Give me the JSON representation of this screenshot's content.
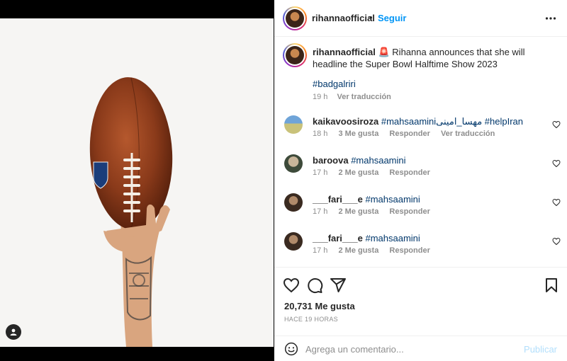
{
  "post": {
    "username": "rihannaofficial",
    "follow_separator": "•",
    "follow_label": "Seguir",
    "more_icon": "more-horizontal-icon"
  },
  "caption": {
    "username": "rihannaofficial",
    "emoji": "🚨",
    "text": "Rihanna announces that she will headline the Super Bowl Halftime Show 2023",
    "hashtag": "#badgalriri",
    "time": "19 h",
    "translate": "Ver traducción"
  },
  "comments": [
    {
      "username": "kaikavoosiroza",
      "text_tag1": "#mahsaamini",
      "text_mid": "مهسا_امینی",
      "text_tag2": "#helpIran",
      "time": "18 h",
      "likes": "3 Me gusta",
      "reply": "Responder",
      "translate": "Ver traducción"
    },
    {
      "username": "baroova",
      "text_tag1": "#mahsaamini",
      "time": "17 h",
      "likes": "2 Me gusta",
      "reply": "Responder"
    },
    {
      "username": "___fari___e",
      "text_tag1": "#mahsaamini",
      "time": "17 h",
      "likes": "2 Me gusta",
      "reply": "Responder"
    },
    {
      "username": "___fari___e",
      "text_tag1": "#mahsaamini",
      "time": "17 h",
      "likes": "2 Me gusta",
      "reply": "Responder"
    }
  ],
  "actions": {
    "likes": "20,731 Me gusta",
    "time": "HACE 19 HORAS"
  },
  "comment_box": {
    "placeholder": "Agrega un comentario...",
    "publish": "Publicar"
  },
  "colors": {
    "accent": "#0095f6",
    "hashtag": "#00376b",
    "muted": "#8e8e8e"
  }
}
